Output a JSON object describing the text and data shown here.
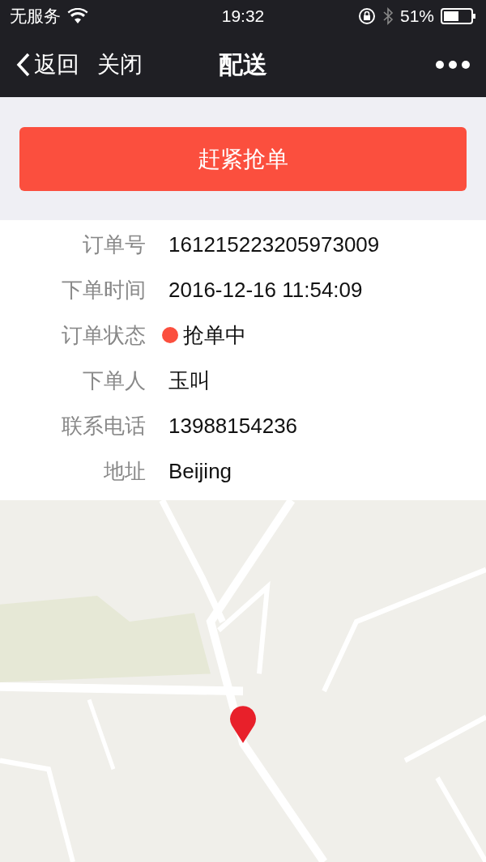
{
  "status_bar": {
    "carrier": "无服务",
    "time": "19:32",
    "battery": "51%"
  },
  "nav": {
    "back": "返回",
    "close": "关闭",
    "title": "配送"
  },
  "action_button": "赶紧抢单",
  "details": [
    {
      "label": "订单号",
      "value": "161215223205973009",
      "kind": "text"
    },
    {
      "label": "下单时间",
      "value": "2016-12-16 11:54:09",
      "kind": "text"
    },
    {
      "label": "订单状态",
      "value": "抢单中",
      "kind": "status",
      "color": "#fb4f3e"
    },
    {
      "label": "下单人",
      "value": "玉叫",
      "kind": "text"
    },
    {
      "label": "联系电话",
      "value": "13988154236",
      "kind": "text"
    },
    {
      "label": "地址",
      "value": "Beijing",
      "kind": "text"
    }
  ]
}
